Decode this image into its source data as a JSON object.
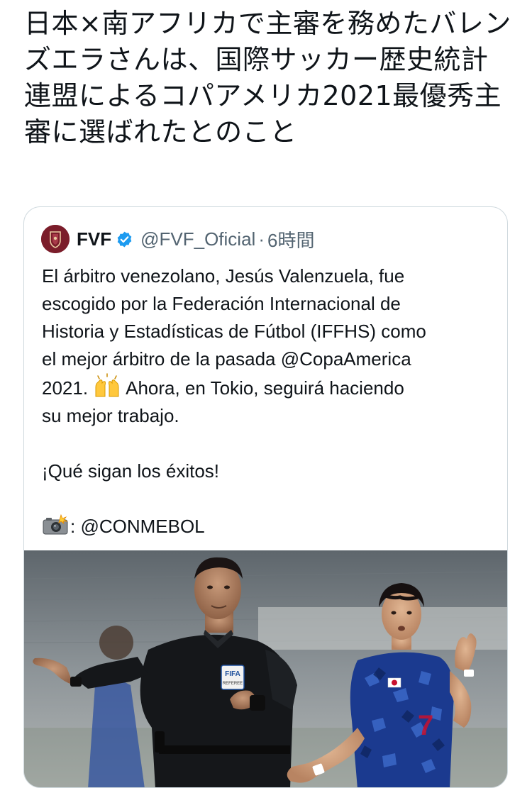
{
  "tweet": {
    "text": "日本×南アフリカで主審を務めたバレンズエラさんは、国際サッカー歴史統計連盟によるコパアメリカ2021最優秀主審に選ばれたとのこと"
  },
  "quoted_tweet": {
    "display_name": "FVF",
    "handle": "@FVF_Oficial",
    "separator": "·",
    "time": "6時間",
    "body": {
      "paragraph_1_line_1": "El árbitro venezolano, Jesús Valenzuela, fue",
      "paragraph_1_line_2": "escogido por la Federación Internacional de",
      "paragraph_1_line_3": "Historia y Estadísticas de Fútbol (IFFHS) como",
      "paragraph_1_line_4": "el mejor árbitro de la pasada @CopaAmerica",
      "paragraph_1_line_5a": "2021.",
      "paragraph_1_line_5b": "Ahora, en Tokio, seguirá haciendo",
      "paragraph_1_line_6": "su mejor trabajo.",
      "paragraph_2": "¡Qué sigan los éxitos!",
      "paragraph_3": ": @CONMEBOL"
    },
    "icons": {
      "verified": "verified-badge-icon",
      "raised_hands": "raising-hands-emoji-icon",
      "camera_flash": "camera-with-flash-emoji-icon"
    },
    "colors": {
      "verified_blue": "#1d9bf0",
      "avatar_maroon": "#7b1d2a",
      "japan_blue": "#1b3a8f"
    },
    "media": {
      "referee_badge_text": "FIFA",
      "referee_badge_subtext": "REFEREE"
    }
  }
}
